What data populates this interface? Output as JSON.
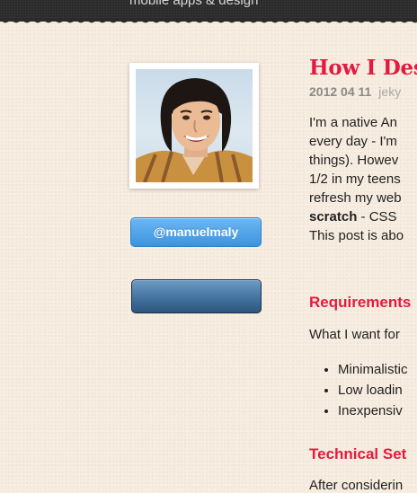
{
  "header": {
    "tagline": "mobile apps & design"
  },
  "sidebar": {
    "twitter_handle": "@manuelmaly",
    "blue_button_label": ""
  },
  "post": {
    "title": "How I Desi",
    "date": "2012 04 11",
    "tag": "jeky",
    "paragraph": [
      "I'm a native An",
      "every day - I'm",
      "things). Howev",
      "1/2 in my teens",
      "refresh my web",
      "scratch",
      " - CSS",
      "This post is abo"
    ],
    "requirements_heading": "Requirements",
    "requirements_intro": "What I want for",
    "requirements": [
      "Minimalistic",
      "Low loadin",
      "Inexpensiv"
    ],
    "technical_heading": "Technical Set",
    "after_text": "After considerin"
  },
  "colors": {
    "accent": "#e31b3f",
    "twitter_blue": "#3b94e0",
    "header": "#2a2a2a"
  }
}
